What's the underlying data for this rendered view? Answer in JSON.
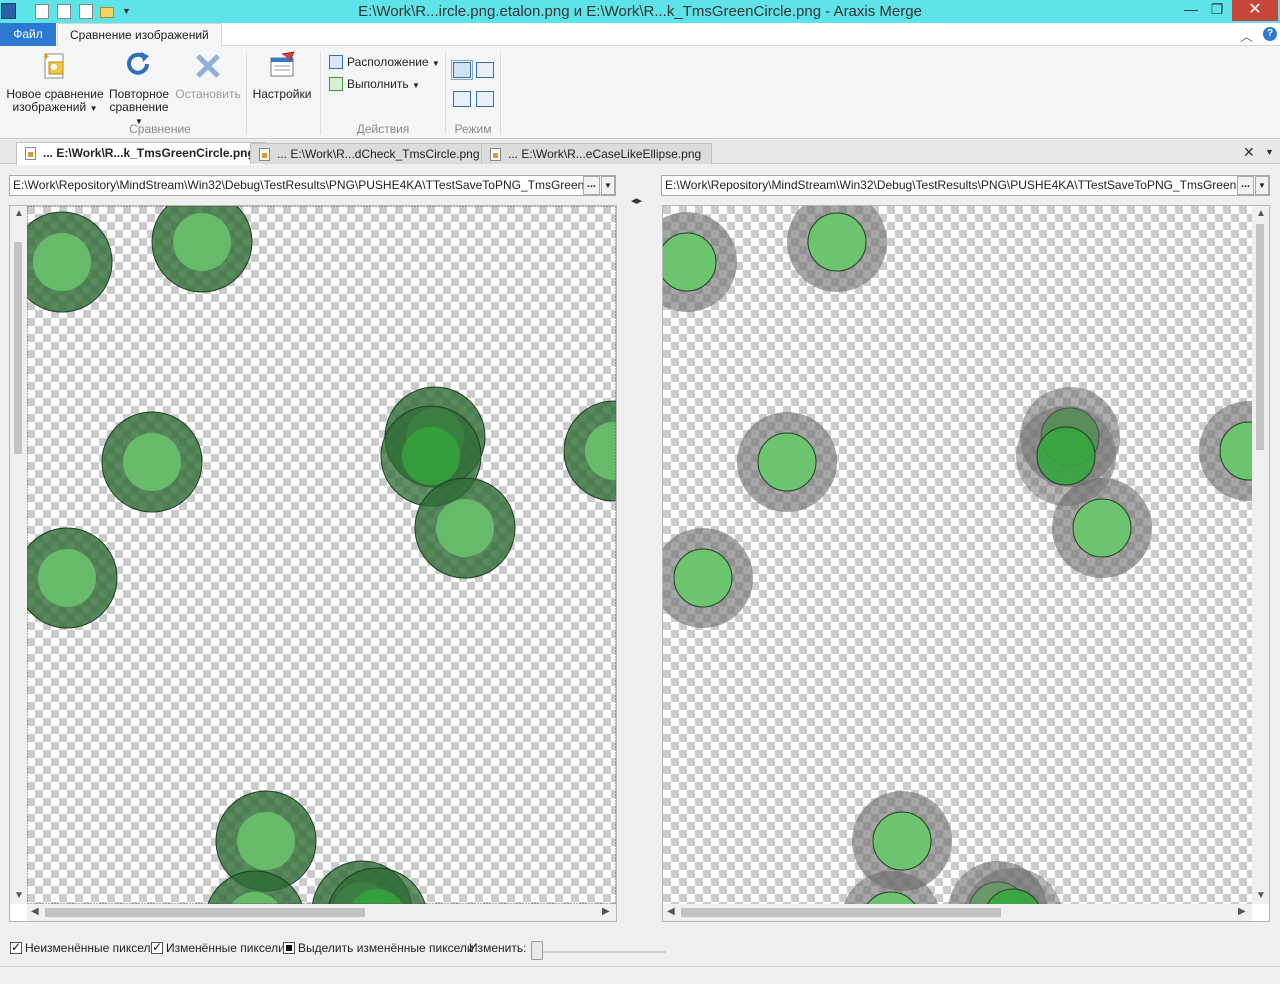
{
  "window": {
    "title": "E:\\Work\\R...ircle.png.etalon.png и E:\\Work\\R...k_TmsGreenCircle.png - Araxis Merge",
    "minimize": "—",
    "maximize": "❐",
    "close": "✕"
  },
  "ribbon_tabs": {
    "file": "Файл",
    "active": "Сравнение изображений"
  },
  "ribbon": {
    "new_compare_line1": "Новое сравнение",
    "new_compare_line2": "изображений",
    "recompare_line1": "Повторное",
    "recompare_line2": "сравнение",
    "stop": "Остановить",
    "settings": "Настройки",
    "group_compare": "Сравнение",
    "layout": "Расположение",
    "execute": "Выполнить",
    "group_actions": "Действия",
    "group_mode": "Режим"
  },
  "doc_tabs": [
    {
      "label": "... E:\\Work\\R...k_TmsGreenCircle.png"
    },
    {
      "label": "... E:\\Work\\R...dCheck_TmsCircle.png"
    },
    {
      "label": "... E:\\Work\\R...eCaseLikeEllipse.png"
    }
  ],
  "paths": {
    "left": "E:\\Work\\Repository\\MindStream\\Win32\\Debug\\TestResults\\PNG\\PUSHE4KA\\TTestSaveToPNG_TmsGreenC",
    "right": "E:\\Work\\Repository\\MindStream\\Win32\\Debug\\TestResults\\PNG\\PUSHE4KA\\TTestSaveToPNG_TmsGreenCi",
    "browse": "...",
    "swap": "◂▸"
  },
  "options": {
    "unchanged": "Неизменённые пиксели",
    "changed": "Изменённые пиксели",
    "highlight": "Выделить изменённые пиксели",
    "change_label": "Изменить:"
  },
  "colors": {
    "accent": "#2b79d0",
    "titlebar": "#5ee3e8",
    "circle_outer": "#2e5a33",
    "circle_inner": "#66bb6a",
    "diff_gray": "#6a6a6a"
  }
}
